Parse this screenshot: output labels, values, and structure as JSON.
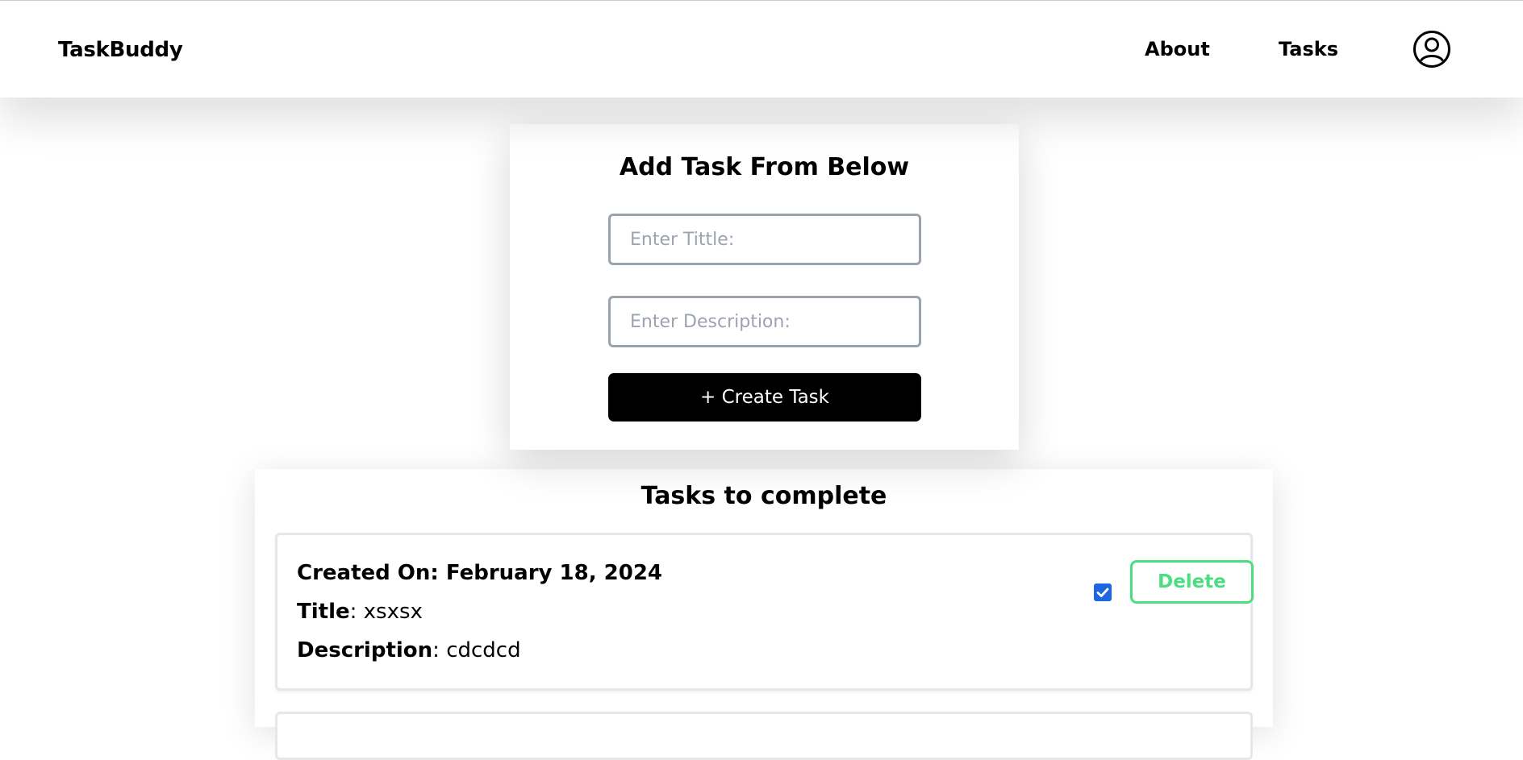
{
  "navbar": {
    "brand": "TaskBuddy",
    "links": [
      "About",
      "Tasks"
    ],
    "profile_icon": "user-circle-icon"
  },
  "add_task_form": {
    "heading": "Add Task From Below",
    "title_placeholder": "Enter Tittle:",
    "title_value": "",
    "description_placeholder": "Enter Description:",
    "description_value": "",
    "create_button_label": "+ Create Task"
  },
  "task_list": {
    "heading": "Tasks to complete",
    "tasks": [
      {
        "created_on": "Created On: February 18, 2024",
        "title_label": "Title",
        "title_value": ": xsxsx",
        "description_label": "Description",
        "description_value": ": cdcdcd",
        "completed": true,
        "delete_label": "Delete"
      }
    ]
  },
  "colors": {
    "accent_green": "#4ade80",
    "checkbox_blue": "#1e66e0",
    "button_black": "#000000"
  }
}
